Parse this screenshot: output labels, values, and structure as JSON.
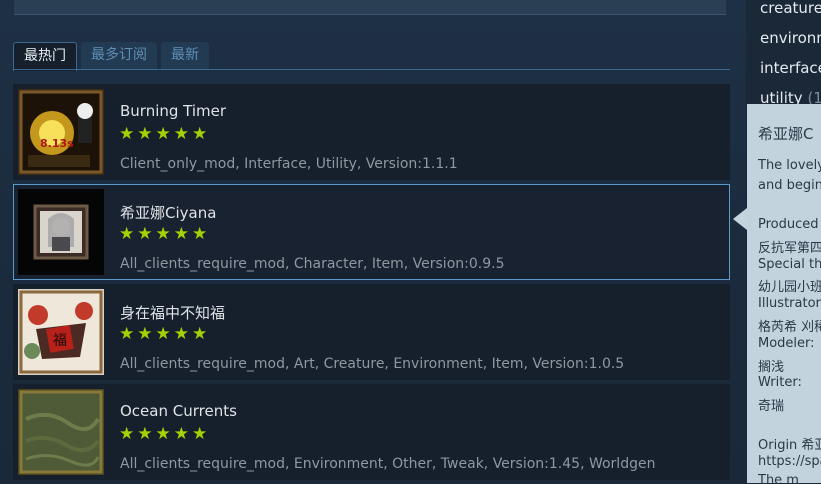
{
  "tabs": [
    {
      "label": "最热门",
      "active": true
    },
    {
      "label": "最多订阅",
      "active": false
    },
    {
      "label": "最新",
      "active": false
    }
  ],
  "items": [
    {
      "title": "Burning Timer",
      "rating": "★★★★★",
      "stars": 5,
      "meta": "Client_only_mod, Interface, Utility, Version:1.1.1",
      "thumb_icon": "burning-timer-thumbnail",
      "thumb_text": "8.13s"
    },
    {
      "title": "希亚娜Ciyana",
      "rating": "★★★★★",
      "stars": 5,
      "meta": "All_clients_require_mod, Character, Item, Version:0.9.5",
      "thumb_icon": "ciyana-thumbnail",
      "selected": true
    },
    {
      "title": "身在福中不知福",
      "rating": "★★★★★",
      "stars": 5,
      "meta": "All_clients_require_mod, Art, Creature, Environment, Item, Version:1.0.5",
      "thumb_icon": "fortune-thumbnail",
      "thumb_text": "福"
    },
    {
      "title": "Ocean Currents",
      "rating": "★★★★★",
      "stars": 5,
      "meta": "All_clients_require_mod, Environment, Other, Tweak, Version:1.45, Worldgen",
      "thumb_icon": "ocean-currents-thumbnail"
    }
  ],
  "side_tags": [
    {
      "label": "creature",
      "count": ""
    },
    {
      "label": "environm",
      "count": ""
    },
    {
      "label": "interface",
      "count": ""
    },
    {
      "label": "utility",
      "count": "(1"
    }
  ],
  "tooltip": {
    "title": "希亚娜C",
    "lines": [
      "The lovely",
      "and begin",
      "",
      "Produced",
      "反抗军第四",
      "Special tha",
      "幼儿园小班",
      "Illustrator:",
      "格芮希 刈稀",
      "Modeler:",
      "搁浅",
      "Writer:",
      "奇瑞",
      "",
      "Origin 希亚",
      "https://spa",
      "The m"
    ]
  },
  "colors": {
    "star": "#a4d007",
    "accent": "#5b9ac8",
    "background": "#1b2838"
  }
}
